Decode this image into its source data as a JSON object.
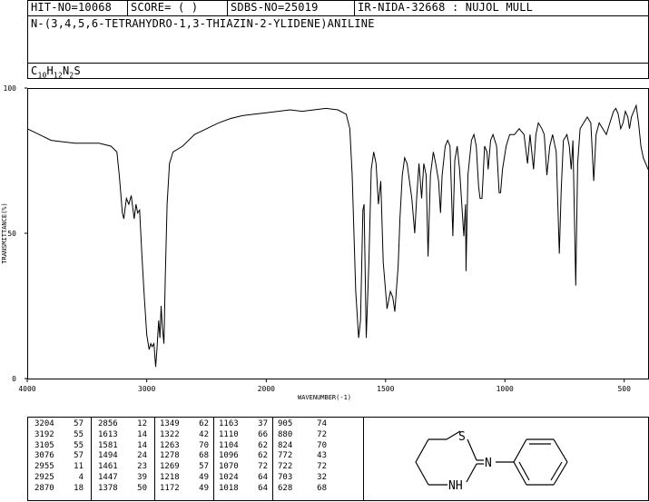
{
  "header": {
    "hit_no": "HIT-NO=10068",
    "score": "SCORE=  (   )",
    "sdbs_no": "SDBS-NO=25019",
    "ir_nida": "IR-NIDA-32668 : NUJOL MULL",
    "compound_name": "N-(3,4,5,6-TETRAHYDRO-1,3-THIAZIN-2-YLIDENE)ANILINE",
    "formula": {
      "c": "C",
      "c_n": "10",
      "h": "H",
      "h_n": "12",
      "n": "N",
      "n_n": "2",
      "s": "S"
    }
  },
  "chart_data": {
    "type": "line",
    "xlabel": "WAVENUMBER(-1)",
    "ylabel": "TRANSMITTANCE(%)",
    "xlim": [
      4000,
      400
    ],
    "ylim": [
      0,
      100
    ],
    "x_ticks": [
      {
        "value": 4000,
        "label": "4000"
      },
      {
        "value": 3000,
        "label": "3000"
      },
      {
        "value": 2000,
        "label": "2000"
      },
      {
        "value": 1500,
        "label": "1500"
      },
      {
        "value": 1000,
        "label": "1000"
      },
      {
        "value": 500,
        "label": "500"
      }
    ],
    "y_ticks": [
      {
        "value": 100,
        "label": "100"
      },
      {
        "value": 50,
        "label": "50"
      },
      {
        "value": 0,
        "label": "0"
      }
    ],
    "x_breakpoint": 2000,
    "series": [
      {
        "color": "#000000",
        "points": [
          [
            4000,
            86
          ],
          [
            3900,
            84
          ],
          [
            3800,
            82
          ],
          [
            3700,
            81.5
          ],
          [
            3600,
            81
          ],
          [
            3500,
            81
          ],
          [
            3400,
            81
          ],
          [
            3300,
            80
          ],
          [
            3250,
            78
          ],
          [
            3230,
            70
          ],
          [
            3204,
            57
          ],
          [
            3192,
            55
          ],
          [
            3170,
            62
          ],
          [
            3150,
            60
          ],
          [
            3130,
            63
          ],
          [
            3105,
            55
          ],
          [
            3090,
            60
          ],
          [
            3076,
            57
          ],
          [
            3060,
            58
          ],
          [
            3040,
            42
          ],
          [
            3020,
            28
          ],
          [
            3000,
            15
          ],
          [
            2980,
            10
          ],
          [
            2966,
            12
          ],
          [
            2955,
            11
          ],
          [
            2940,
            12
          ],
          [
            2925,
            4
          ],
          [
            2915,
            10
          ],
          [
            2900,
            20
          ],
          [
            2890,
            14
          ],
          [
            2880,
            25
          ],
          [
            2870,
            18
          ],
          [
            2856,
            12
          ],
          [
            2845,
            35
          ],
          [
            2830,
            60
          ],
          [
            2810,
            74
          ],
          [
            2780,
            78
          ],
          [
            2700,
            80
          ],
          [
            2600,
            84
          ],
          [
            2500,
            86
          ],
          [
            2400,
            88
          ],
          [
            2300,
            89.5
          ],
          [
            2200,
            90.5
          ],
          [
            2100,
            91
          ],
          [
            2000,
            91.5
          ],
          [
            1950,
            92
          ],
          [
            1900,
            92.5
          ],
          [
            1850,
            92
          ],
          [
            1800,
            92.5
          ],
          [
            1750,
            93
          ],
          [
            1700,
            92.5
          ],
          [
            1665,
            91
          ],
          [
            1650,
            86
          ],
          [
            1640,
            70
          ],
          [
            1625,
            30
          ],
          [
            1613,
            14
          ],
          [
            1605,
            20
          ],
          [
            1595,
            58
          ],
          [
            1590,
            60
          ],
          [
            1581,
            14
          ],
          [
            1570,
            40
          ],
          [
            1560,
            72
          ],
          [
            1550,
            78
          ],
          [
            1540,
            74
          ],
          [
            1530,
            60
          ],
          [
            1520,
            68
          ],
          [
            1510,
            40
          ],
          [
            1494,
            24
          ],
          [
            1480,
            30
          ],
          [
            1470,
            28
          ],
          [
            1461,
            23
          ],
          [
            1455,
            30
          ],
          [
            1447,
            39
          ],
          [
            1440,
            55
          ],
          [
            1430,
            70
          ],
          [
            1420,
            76
          ],
          [
            1410,
            74
          ],
          [
            1400,
            68
          ],
          [
            1390,
            62
          ],
          [
            1378,
            50
          ],
          [
            1370,
            62
          ],
          [
            1360,
            74
          ],
          [
            1349,
            62
          ],
          [
            1340,
            74
          ],
          [
            1330,
            70
          ],
          [
            1322,
            42
          ],
          [
            1312,
            70
          ],
          [
            1300,
            78
          ],
          [
            1290,
            74
          ],
          [
            1278,
            68
          ],
          [
            1270,
            57
          ],
          [
            1263,
            70
          ],
          [
            1250,
            80
          ],
          [
            1240,
            82
          ],
          [
            1230,
            80
          ],
          [
            1218,
            49
          ],
          [
            1210,
            75
          ],
          [
            1200,
            80
          ],
          [
            1190,
            72
          ],
          [
            1172,
            49
          ],
          [
            1165,
            60
          ],
          [
            1163,
            37
          ],
          [
            1155,
            70
          ],
          [
            1140,
            82
          ],
          [
            1130,
            84
          ],
          [
            1120,
            80
          ],
          [
            1110,
            66
          ],
          [
            1104,
            62
          ],
          [
            1096,
            62
          ],
          [
            1085,
            80
          ],
          [
            1075,
            78
          ],
          [
            1070,
            72
          ],
          [
            1060,
            82
          ],
          [
            1050,
            84
          ],
          [
            1035,
            80
          ],
          [
            1024,
            64
          ],
          [
            1018,
            64
          ],
          [
            1010,
            72
          ],
          [
            995,
            80
          ],
          [
            980,
            84
          ],
          [
            960,
            84
          ],
          [
            940,
            86
          ],
          [
            920,
            84
          ],
          [
            905,
            74
          ],
          [
            895,
            84
          ],
          [
            880,
            72
          ],
          [
            870,
            84
          ],
          [
            860,
            88
          ],
          [
            845,
            86
          ],
          [
            835,
            84
          ],
          [
            824,
            70
          ],
          [
            812,
            80
          ],
          [
            800,
            84
          ],
          [
            785,
            78
          ],
          [
            772,
            43
          ],
          [
            764,
            65
          ],
          [
            755,
            82
          ],
          [
            740,
            84
          ],
          [
            730,
            80
          ],
          [
            722,
            72
          ],
          [
            715,
            82
          ],
          [
            703,
            32
          ],
          [
            695,
            74
          ],
          [
            685,
            86
          ],
          [
            670,
            88
          ],
          [
            655,
            90
          ],
          [
            640,
            88
          ],
          [
            628,
            68
          ],
          [
            618,
            84
          ],
          [
            605,
            88
          ],
          [
            590,
            86
          ],
          [
            575,
            84
          ],
          [
            560,
            88
          ],
          [
            545,
            92
          ],
          [
            535,
            93
          ],
          [
            525,
            91
          ],
          [
            515,
            86
          ],
          [
            505,
            88
          ],
          [
            495,
            92
          ],
          [
            485,
            90
          ],
          [
            478,
            86
          ],
          [
            470,
            90
          ],
          [
            460,
            92
          ],
          [
            450,
            94
          ],
          [
            440,
            88
          ],
          [
            430,
            80
          ],
          [
            420,
            76
          ],
          [
            410,
            74
          ],
          [
            400,
            72
          ]
        ]
      }
    ]
  },
  "peak_table": {
    "columns": [
      [
        [
          "3204",
          "57"
        ],
        [
          "3192",
          "55"
        ],
        [
          "3105",
          "55"
        ],
        [
          "3076",
          "57"
        ],
        [
          "2955",
          "11"
        ],
        [
          "2925",
          "4"
        ],
        [
          "2870",
          "18"
        ]
      ],
      [
        [
          "2856",
          "12"
        ],
        [
          "1613",
          "14"
        ],
        [
          "1581",
          "14"
        ],
        [
          "1494",
          "24"
        ],
        [
          "1461",
          "23"
        ],
        [
          "1447",
          "39"
        ],
        [
          "1378",
          "50"
        ]
      ],
      [
        [
          "1349",
          "62"
        ],
        [
          "1322",
          "42"
        ],
        [
          "1263",
          "70"
        ],
        [
          "1278",
          "68"
        ],
        [
          "1269",
          "57"
        ],
        [
          "1218",
          "49"
        ],
        [
          "1172",
          "49"
        ]
      ],
      [
        [
          "1163",
          "37"
        ],
        [
          "1110",
          "66"
        ],
        [
          "1104",
          "62"
        ],
        [
          "1096",
          "62"
        ],
        [
          "1070",
          "72"
        ],
        [
          "1024",
          "64"
        ],
        [
          "1018",
          "64"
        ]
      ],
      [
        [
          "905",
          "74"
        ],
        [
          "880",
          "72"
        ],
        [
          "824",
          "70"
        ],
        [
          "772",
          "43"
        ],
        [
          "722",
          "72"
        ],
        [
          "703",
          "32"
        ],
        [
          "628",
          "68"
        ]
      ]
    ]
  },
  "structure": {
    "atom_s": "S",
    "atom_n": "N",
    "atom_nh": "NH"
  }
}
